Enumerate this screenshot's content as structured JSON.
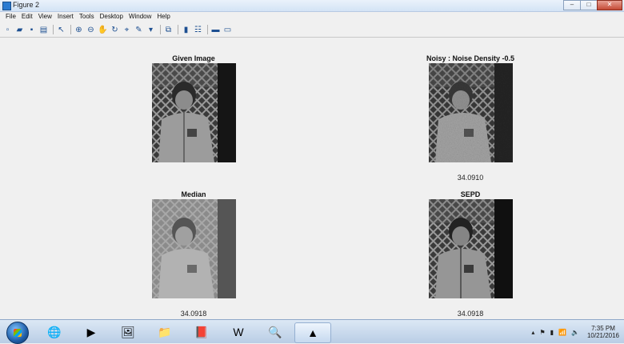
{
  "window": {
    "title": "Figure 2",
    "buttons": [
      "–",
      "□",
      "✕"
    ]
  },
  "menu": [
    "File",
    "Edit",
    "View",
    "Insert",
    "Tools",
    "Desktop",
    "Window",
    "Help"
  ],
  "panels": [
    {
      "title": "Given Image",
      "value": ""
    },
    {
      "title": "Noisy : Noise Density -0.5",
      "value": "34.0910"
    },
    {
      "title": "Median",
      "value": "34.0918"
    },
    {
      "title": "SEPD",
      "value": "34.0918"
    }
  ],
  "taskbar": {
    "apps": [
      "ie-icon",
      "media-icon",
      "photos-icon",
      "folder-icon",
      "pdf-icon",
      "word-icon",
      "search-icon",
      "matlab-icon"
    ],
    "clock_time": "7:35 PM",
    "clock_date": "10/21/2016"
  },
  "colors": {
    "titlebar": "#d3e3f5",
    "background": "#f0f0f0"
  }
}
